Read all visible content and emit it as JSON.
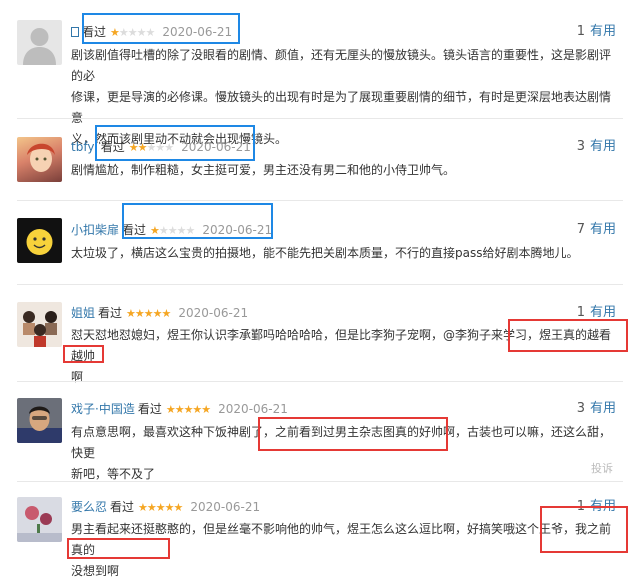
{
  "colors": {
    "link": "#3377aa",
    "star": "#f5a623",
    "blue_box": "#1e88e5",
    "red_box": "#e53935"
  },
  "reviews": [
    {
      "user": "",
      "user_icon": "unknown-glyph",
      "status": "看过",
      "rating": 1,
      "date": "2020-06-21",
      "useful_count": "1",
      "useful_label": "有用",
      "avatar": "default-avatar-icon",
      "lines": [
        "剧该剧值得吐槽的除了没眼看的剧情、颜值，还有无厘头的慢放镜头。镜头语言的重要性，这是影剧评的必",
        "修课，更是导演的必修课。慢放镜头的出现有时是为了展现重要剧情的细节，有时是更深层地表达剧情意",
        "义，然而该剧里动不动就会出现慢镜头。"
      ]
    },
    {
      "user": "tbfyl",
      "status": "看过",
      "rating": 2,
      "date": "2020-06-21",
      "useful_count": "3",
      "useful_label": "有用",
      "avatar": "anime-character-avatar",
      "lines": [
        "剧情尴尬，制作粗糙，女主挺可爱，男主还没有男二和他的小侍卫帅气。"
      ]
    },
    {
      "user": "小扣柴扉",
      "status": "看过",
      "rating": 1,
      "date": "2020-06-21",
      "useful_count": "7",
      "useful_label": "有用",
      "avatar": "smiley-face-avatar",
      "lines": [
        "太垃圾了，横店这么宝贵的拍摄地，能不能先把关剧本质量，不行的直接pass给好剧本腾地儿。"
      ]
    },
    {
      "user": "姐姐",
      "status": "看过",
      "rating": 5,
      "date": "2020-06-21",
      "useful_count": "1",
      "useful_label": "有用",
      "avatar": "group-photo-avatar",
      "lines": [
        "怼天怼地怼媳妇，煜王你认识李承鄞吗哈哈哈哈，但是比李狗子宠啊，@李狗子来学习，煜王真的越看越帅",
        "啊"
      ]
    },
    {
      "user": "戏子·中国造",
      "status": "看过",
      "rating": 5,
      "date": "2020-06-21",
      "useful_count": "3",
      "useful_label": "有用",
      "avatar": "man-portrait-avatar",
      "report_label": "投诉",
      "lines": [
        "有点意思啊，最喜欢这种下饭神剧了，之前看到过男主杂志图真的好帅啊，古装也可以嘛，还这么甜，快更",
        "新吧，等不及了"
      ]
    },
    {
      "user": "要么忍",
      "status": "看过",
      "rating": 5,
      "date": "2020-06-21",
      "useful_count": "1",
      "useful_label": "有用",
      "avatar": "flower-photo-avatar",
      "lines": [
        "男主看起来还挺憨憨的，但是丝毫不影响他的帅气，煜王怎么这么逗比啊，好搞笑哦这个王爷，我之前真的",
        "没想到啊"
      ]
    }
  ]
}
